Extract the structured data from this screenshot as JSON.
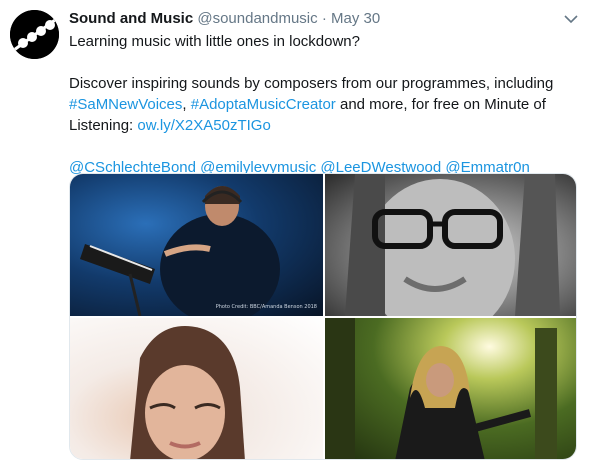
{
  "account": {
    "name": "Sound and Music",
    "handle": "@soundandmusic",
    "separator": "·",
    "date": "May 30"
  },
  "tweet": {
    "line1": "Learning music with little ones in lockdown?",
    "para2_prefix": "Discover inspiring sounds by composers from our programmes, including ",
    "hashtag1": "#SaMNewVoices",
    "comma": ", ",
    "hashtag2": "#AdoptaMusicCreator",
    "para2_middle": " and more, for free on Minute of Listening: ",
    "link": "ow.ly/X2XA50zTIGo",
    "mentions": [
      "@CSchlechteBond",
      "@emilylevymusic",
      "@LeeDWestwood",
      "@Emmatr0n"
    ]
  },
  "media": {
    "photo1_credit": "Photo Credit: BBC/Amanda Benson 2018"
  },
  "icons": {
    "avatar": "sound-and-music-logo",
    "caret": "chevron-down-icon"
  },
  "colors": {
    "link": "#1b95e0",
    "muted": "#657786",
    "text": "#14171a"
  }
}
